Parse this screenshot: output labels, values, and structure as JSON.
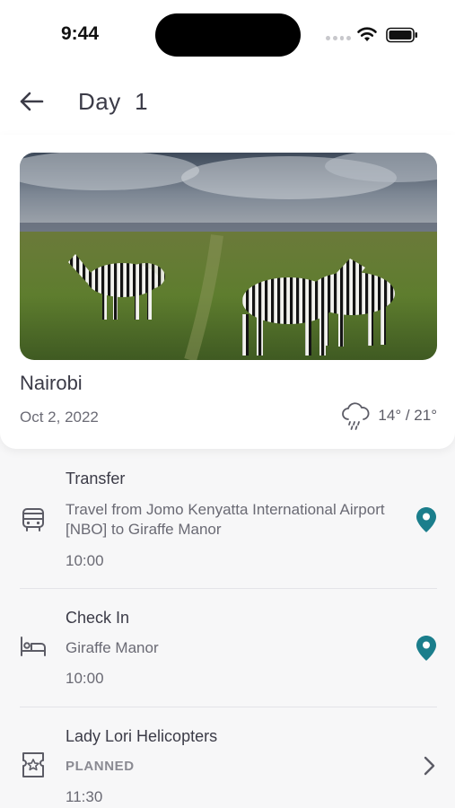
{
  "status_bar": {
    "time": "9:44"
  },
  "header": {
    "title": "Day  1"
  },
  "hero": {
    "city": "Nairobi",
    "date": "Oct 2, 2022",
    "weather_icon": "rain-cloud-icon",
    "temperature": "14° / 21°"
  },
  "items": [
    {
      "title": "Transfer",
      "description": "Travel from Jomo Kenyatta International Airport [NBO] to Giraffe Manor",
      "time": "10:00",
      "icon": "bus-icon",
      "action_icon": "map-pin-icon"
    },
    {
      "title": "Check In",
      "description": "Giraffe Manor",
      "time": "10:00",
      "icon": "bed-icon",
      "action_icon": "map-pin-icon"
    },
    {
      "title": "Lady Lori Helicopters",
      "status": "PLANNED",
      "time": "11:30",
      "icon": "ticket-star-icon",
      "action_icon": "chevron-right-icon"
    }
  ],
  "colors": {
    "accent": "#1b7e8c",
    "text_primary": "#3b3b47",
    "text_secondary": "#6a6a74"
  }
}
